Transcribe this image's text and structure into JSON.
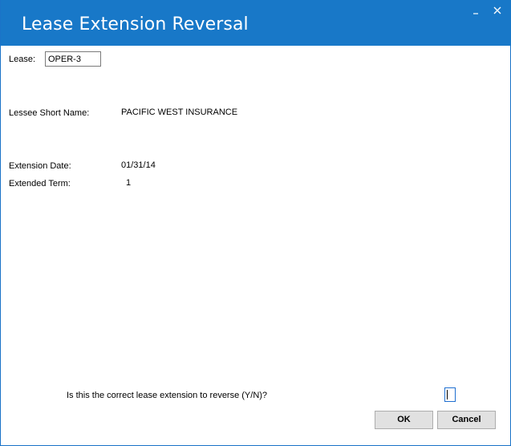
{
  "window": {
    "title": "Lease Extension Reversal",
    "minimize_glyph": "_",
    "close_glyph": "✕",
    "titlebar_color": "#1878c8"
  },
  "form": {
    "lease_label": "Lease:",
    "lease_value": "OPER-3",
    "lessee_label": "Lessee Short Name:",
    "lessee_value": "PACIFIC WEST INSURANCE",
    "extension_date_label": "Extension Date:",
    "extension_date_value": "01/31/14",
    "extended_term_label": "Extended Term:",
    "extended_term_value": "1",
    "confirm_prompt": "Is this the correct lease extension to reverse (Y/N)?",
    "confirm_value": ""
  },
  "buttons": {
    "ok_label": "OK",
    "cancel_label": "Cancel"
  }
}
